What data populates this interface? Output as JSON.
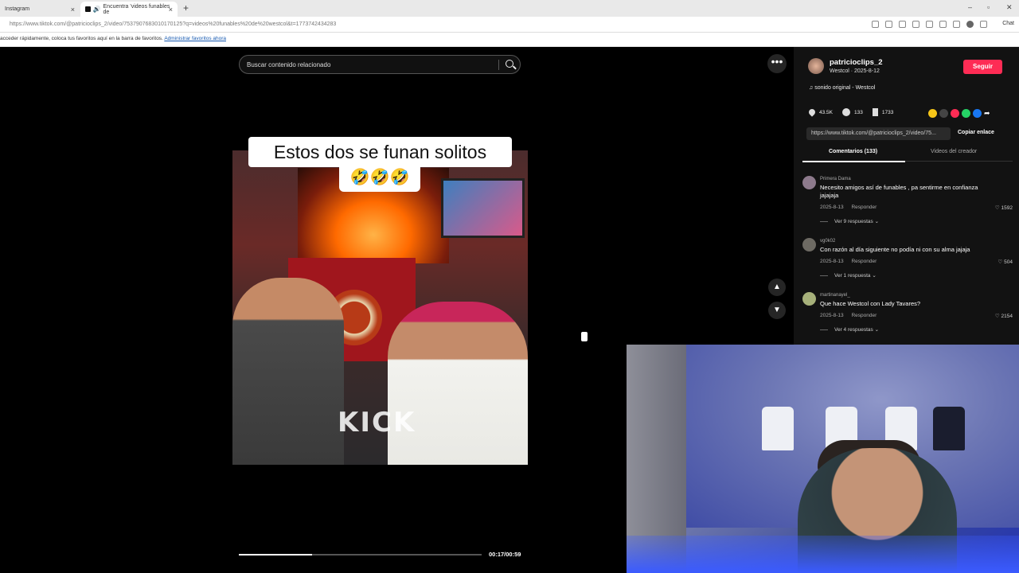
{
  "browser": {
    "tabs": [
      {
        "label": "Instagram"
      },
      {
        "label": "Encuentra 'videos funables de"
      }
    ],
    "url": "https://www.tiktok.com/@patricioclips_2/video/7537907683010170125?q=videos%20funables%20de%20westcol&t=1773742434283",
    "chat_label": "Chat",
    "favbar_text": "acceder rápidamente, coloca tus favoritos aquí en la barra de favoritos.",
    "favbar_link": "Administrar favoritos ahora"
  },
  "search": {
    "placeholder": "Buscar contenido relacionado"
  },
  "video": {
    "caption": "Estos dos se funan  solitos",
    "emojis": "🤣🤣🤣",
    "watermark": "KICK",
    "time": "00:17/00:59",
    "progress": 0.3
  },
  "author": {
    "name": "patricioclips_2",
    "sub": "Westcol · 2025-8-12",
    "follow_label": "Seguir",
    "sound": "sonido original - Westcol"
  },
  "stats": {
    "likes": "43.5K",
    "comments": "133",
    "saves": "1733"
  },
  "share": {
    "link": "https://www.tiktok.com/@patricioclips_2/video/75...",
    "copy_label": "Copiar enlace"
  },
  "tabs": {
    "comments": "Comentarios (133)",
    "creator": "Videos del creador"
  },
  "comments": [
    {
      "user": "Primera Dama",
      "text": "Necesito amigos así de funables , pa sentirme en confianza jajajaja",
      "date": "2025-8-13",
      "reply": "Responder",
      "likes": "1592",
      "replies": "Ver 9 respuestas"
    },
    {
      "user": "vg0k02",
      "text": "Con razón al día siguiente no podía ni con su alma jajaja",
      "date": "2025-8-13",
      "reply": "Responder",
      "likes": "504",
      "replies": "Ver 1 respuesta"
    },
    {
      "user": "martinanayel_",
      "text": "Que hace Westcol con Lady Tavares?",
      "date": "2025-8-13",
      "reply": "Responder",
      "likes": "2154",
      "replies": "Ver 4 respuestas"
    }
  ],
  "colors": {
    "follow": "#fe2c55",
    "panel": "#121212"
  }
}
